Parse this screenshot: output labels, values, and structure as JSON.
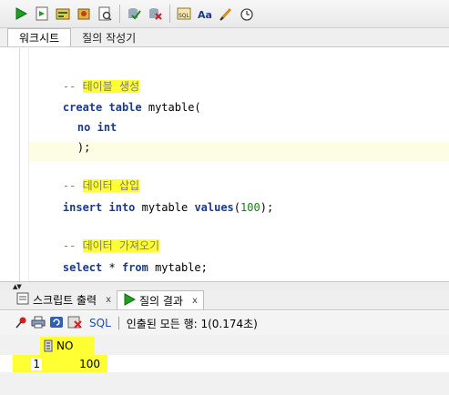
{
  "toolbar": {
    "icons": [
      "run-statement-icon",
      "run-script-icon",
      "autotrace-icon",
      "explain-plan-icon",
      "sql-tuning-icon",
      "commit-icon",
      "rollback-icon",
      "unshared-sql-icon",
      "to-upper-lower-icon",
      "clear-icon",
      "sql-history-icon"
    ]
  },
  "tabs": {
    "worksheet": "워크시트",
    "query_builder": "질의 작성기"
  },
  "editor": {
    "lines": {
      "c1_prefix": "-- ",
      "c1_text": "테이블 생성",
      "l2_kw1": "create",
      "l2_kw2": "table",
      "l2_rest": " mytable(",
      "l3_kw1": "no",
      "l3_kw2": "int",
      "l4": ");",
      "c2_prefix": "-- ",
      "c2_text": "데이터 삽입",
      "l6_kw1": "insert",
      "l6_kw2": "into",
      "l6_mid": " mytable ",
      "l6_kw3": "values",
      "l6_open": "(",
      "l6_num": "100",
      "l6_close": ");",
      "c3_prefix": "-- ",
      "c3_text": "데이터 가져오기",
      "l8_kw1": "select",
      "l8_mid": " * ",
      "l8_kw2": "from",
      "l8_rest": " mytable;"
    }
  },
  "bottom_tabs": {
    "script_output": "스크립트 출력",
    "query_result": "질의 결과",
    "close": "x"
  },
  "result_toolbar": {
    "sql_label": "SQL",
    "status": "인출된 모든 행: 1(0.174초)"
  },
  "grid": {
    "columns": [
      "NO"
    ],
    "rows": [
      {
        "index": "1",
        "values": [
          "100"
        ]
      }
    ]
  },
  "colors": {
    "highlight": "#ffff33",
    "keyword": "#1b3a8c",
    "comment": "#7a7a7a",
    "number": "#1a7a1a"
  }
}
